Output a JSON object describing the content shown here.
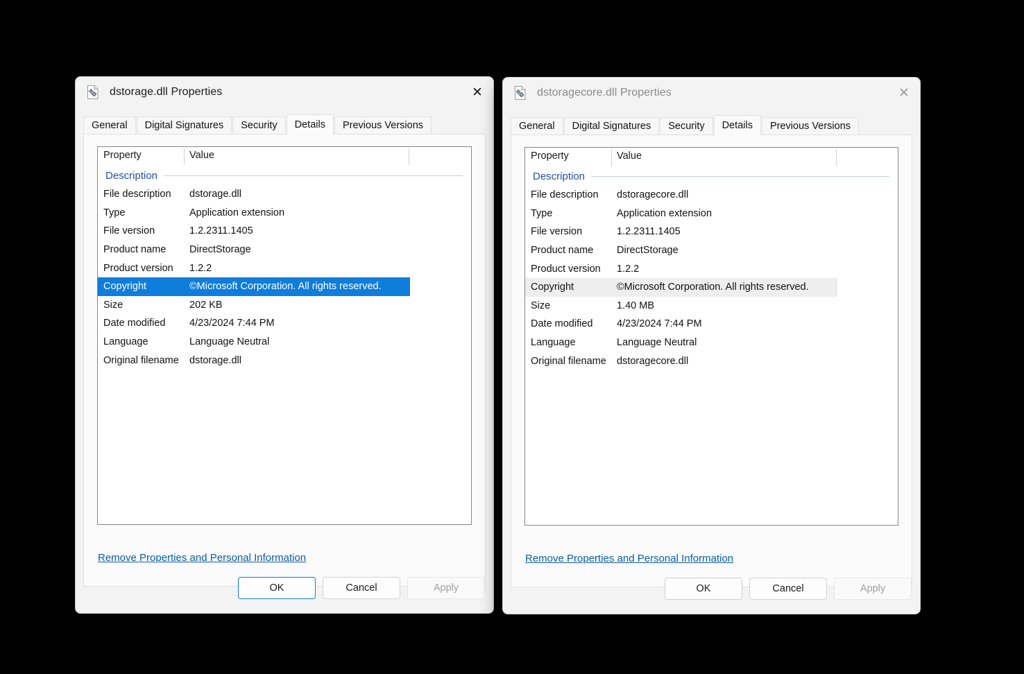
{
  "windows": [
    {
      "id": "dstorage",
      "active": true,
      "title": "dstorage.dll Properties",
      "icon": "dll-file-icon",
      "close_label": "✕",
      "tabs": [
        {
          "label": "General",
          "selected": false
        },
        {
          "label": "Digital Signatures",
          "selected": false
        },
        {
          "label": "Security",
          "selected": false
        },
        {
          "label": "Details",
          "selected": true
        },
        {
          "label": "Previous Versions",
          "selected": false
        }
      ],
      "list": {
        "header": {
          "property": "Property",
          "value": "Value"
        },
        "group": "Description",
        "rows": [
          {
            "property": "File description",
            "value": "dstorage.dll",
            "selected": false
          },
          {
            "property": "Type",
            "value": "Application extension",
            "selected": false
          },
          {
            "property": "File version",
            "value": "1.2.2311.1405",
            "selected": false
          },
          {
            "property": "Product name",
            "value": "DirectStorage",
            "selected": false
          },
          {
            "property": "Product version",
            "value": "1.2.2",
            "selected": false
          },
          {
            "property": "Copyright",
            "value": "©Microsoft Corporation.  All rights reserved.",
            "selected": true
          },
          {
            "property": "Size",
            "value": "202 KB",
            "selected": false
          },
          {
            "property": "Date modified",
            "value": "4/23/2024 7:44 PM",
            "selected": false
          },
          {
            "property": "Language",
            "value": "Language Neutral",
            "selected": false
          },
          {
            "property": "Original filename",
            "value": "dstorage.dll",
            "selected": false
          }
        ]
      },
      "remove_link": "Remove Properties and Personal Information",
      "buttons": {
        "ok": "OK",
        "cancel": "Cancel",
        "apply": "Apply"
      }
    },
    {
      "id": "dstoragecore",
      "active": false,
      "title": "dstoragecore.dll Properties",
      "icon": "dll-file-icon",
      "close_label": "✕",
      "tabs": [
        {
          "label": "General",
          "selected": false
        },
        {
          "label": "Digital Signatures",
          "selected": false
        },
        {
          "label": "Security",
          "selected": false
        },
        {
          "label": "Details",
          "selected": true
        },
        {
          "label": "Previous Versions",
          "selected": false
        }
      ],
      "list": {
        "header": {
          "property": "Property",
          "value": "Value"
        },
        "group": "Description",
        "rows": [
          {
            "property": "File description",
            "value": "dstoragecore.dll",
            "selected": false
          },
          {
            "property": "Type",
            "value": "Application extension",
            "selected": false
          },
          {
            "property": "File version",
            "value": "1.2.2311.1405",
            "selected": false
          },
          {
            "property": "Product name",
            "value": "DirectStorage",
            "selected": false
          },
          {
            "property": "Product version",
            "value": "1.2.2",
            "selected": false
          },
          {
            "property": "Copyright",
            "value": "©Microsoft Corporation.  All rights reserved.",
            "selected": true
          },
          {
            "property": "Size",
            "value": "1.40 MB",
            "selected": false
          },
          {
            "property": "Date modified",
            "value": "4/23/2024 7:44 PM",
            "selected": false
          },
          {
            "property": "Language",
            "value": "Language Neutral",
            "selected": false
          },
          {
            "property": "Original filename",
            "value": "dstoragecore.dll",
            "selected": false
          }
        ]
      },
      "remove_link": "Remove Properties and Personal Information",
      "buttons": {
        "ok": "OK",
        "cancel": "Cancel",
        "apply": "Apply"
      }
    }
  ],
  "colors": {
    "selection_active": "#0f7ddb",
    "selection_inactive": "#eeeeee",
    "group_header": "#1c51a8",
    "link": "#0a5ca8",
    "desktop": "#000000"
  }
}
